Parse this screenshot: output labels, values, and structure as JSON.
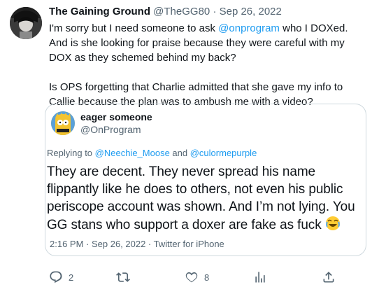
{
  "tweet": {
    "display_name": "The Gaining Ground",
    "handle": "@TheGG80",
    "separator": "·",
    "date": "Sep 26, 2022",
    "text_p1_before": "I'm sorry but I need someone to ask ",
    "text_p1_mention": "@onprogram",
    "text_p1_after": " who I DOXed. And is she looking for praise because they were careful with my DOX as they schemed behind my back?",
    "text_p2": "Is OPS forgetting that Charlie admitted that she gave my info to Callie because the plan was to ambush me with a video?"
  },
  "quoted": {
    "display_name": "eager someone",
    "handle": "@OnProgram",
    "replying_prefix": "Replying to ",
    "replying_user1": "@Neechie_Moose",
    "replying_and": " and ",
    "replying_user2": "@culormepurple",
    "text": "They are decent. They never spread his name flippantly like he does to others, not even his public periscope account was shown. And I’m not lying. You GG stans who support a doxer are fake as fuck ",
    "emoji": "😂",
    "timestamp": "2:16 PM · Sep 26, 2022 · Twitter for iPhone"
  },
  "actions": {
    "reply_count": "2",
    "retweet_count": "",
    "like_count": "8"
  },
  "icons": {
    "reply": "reply-icon",
    "retweet": "retweet-icon",
    "like": "heart-icon",
    "views": "analytics-icon",
    "share": "share-icon"
  }
}
